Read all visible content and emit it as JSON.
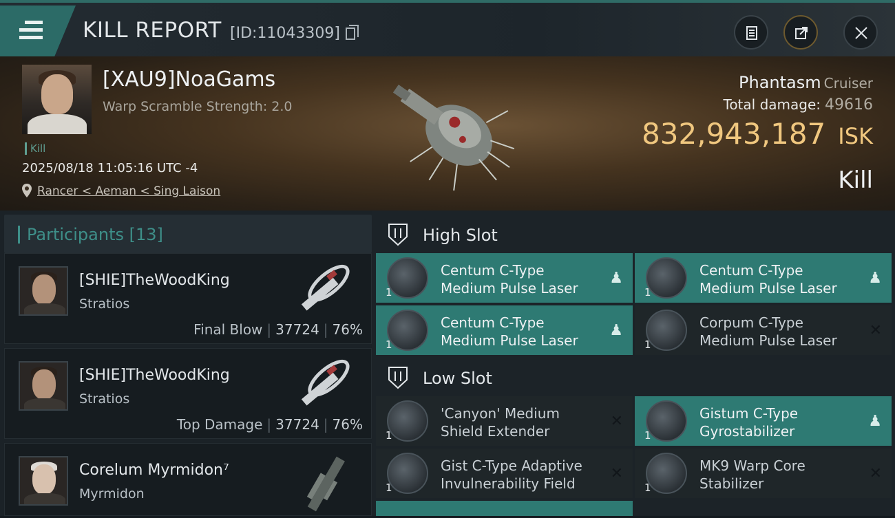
{
  "header": {
    "title": "KILL REPORT",
    "kill_id": "[ID:11043309]"
  },
  "victim": {
    "name": "[XAU9]NoaGams",
    "warp_scramble": "Warp Scramble Strength: 2.0",
    "tag": "Kill",
    "datetime": "2025/08/18 11:05:16 UTC -4",
    "location": "Rancer < Aeman < Sing Laison",
    "ship_name": "Phantasm",
    "ship_class": "Cruiser",
    "total_damage_label": "Total damage:",
    "total_damage": "49616",
    "isk_value": "832,943,187",
    "isk_unit": "ISK",
    "result": "Kill"
  },
  "participants": {
    "label": "Participants",
    "count": "[13]",
    "list": [
      {
        "name": "[SHIE]TheWoodKing",
        "ship": "Stratios",
        "role": "Final Blow",
        "damage": "37724",
        "percent": "76%"
      },
      {
        "name": "[SHIE]TheWoodKing",
        "ship": "Stratios",
        "role": "Top Damage",
        "damage": "37724",
        "percent": "76%"
      },
      {
        "name": "Corelum Myrmidon⁷",
        "ship": "Myrmidon",
        "role": "",
        "damage": "",
        "percent": ""
      }
    ]
  },
  "slots": {
    "high": {
      "label": "High Slot",
      "items": [
        {
          "line1": "Centum C-Type",
          "line2": "Medium Pulse Laser",
          "qty": "1",
          "state": "fitted"
        },
        {
          "line1": "Centum C-Type",
          "line2": "Medium Pulse Laser",
          "qty": "1",
          "state": "fitted"
        },
        {
          "line1": "Centum C-Type",
          "line2": "Medium Pulse Laser",
          "qty": "1",
          "state": "fitted"
        },
        {
          "line1": "Corpum C-Type",
          "line2": "Medium Pulse Laser",
          "qty": "1",
          "state": "destroyed"
        }
      ]
    },
    "low": {
      "label": "Low Slot",
      "items": [
        {
          "line1": "'Canyon' Medium",
          "line2": "Shield Extender",
          "qty": "1",
          "state": "destroyed"
        },
        {
          "line1": "Gistum C-Type",
          "line2": "Gyrostabilizer",
          "qty": "1",
          "state": "fitted"
        },
        {
          "line1": "Gist C-Type Adaptive",
          "line2": "Invulnerability Field",
          "qty": "1",
          "state": "destroyed"
        },
        {
          "line1": "MK9 Warp Core",
          "line2": "Stabilizer",
          "qty": "1",
          "state": "destroyed"
        }
      ]
    }
  },
  "icons": {
    "fitted": "person-icon",
    "destroyed": "x-icon"
  },
  "colors": {
    "accent": "#2e7a73",
    "isk": "#f0c77f",
    "participants_label": "#3e8f89"
  }
}
